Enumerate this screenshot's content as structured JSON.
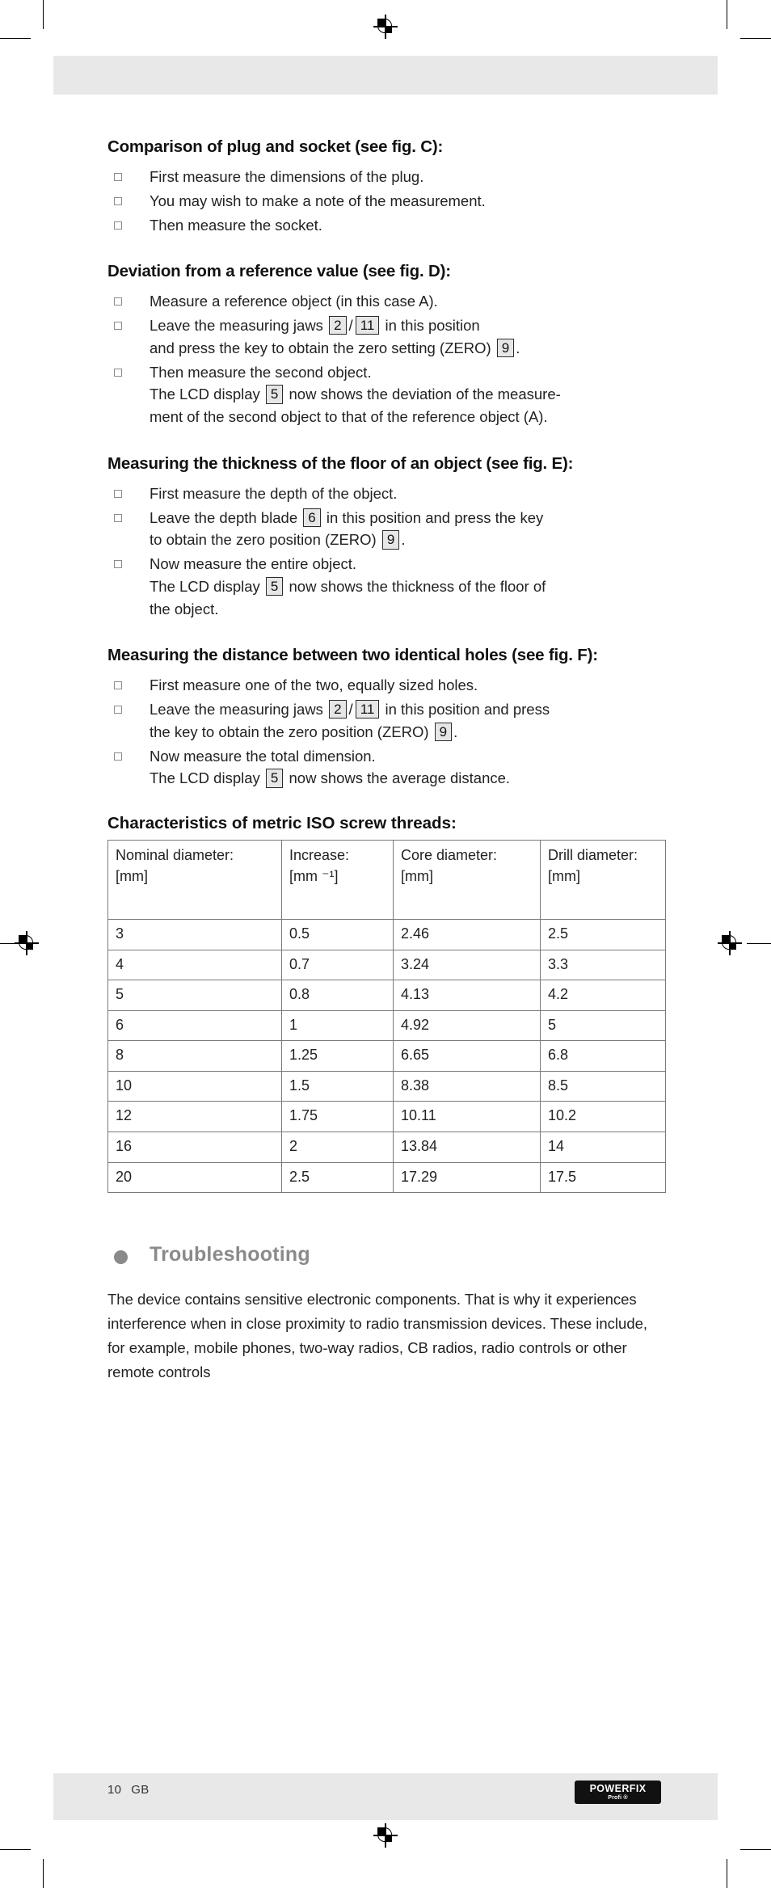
{
  "page": {
    "footer_page_number": "10",
    "footer_language_code": "GB",
    "brand_name": "POWERFIX",
    "brand_sub": "Profi ®"
  },
  "sections": [
    {
      "heading": "Comparison of plug and socket (see fig. C):",
      "steps": [
        {
          "parts": [
            {
              "t": "text",
              "v": "First measure the dimensions of the plug."
            }
          ]
        },
        {
          "parts": [
            {
              "t": "text",
              "v": "You may wish to make a note of the measurement."
            }
          ]
        },
        {
          "parts": [
            {
              "t": "text",
              "v": "Then measure the socket."
            }
          ]
        }
      ]
    },
    {
      "heading": "Deviation from a reference value (see fig. D):",
      "steps": [
        {
          "parts": [
            {
              "t": "text",
              "v": "Measure a reference object (in this case A)."
            }
          ]
        },
        {
          "parts": [
            {
              "t": "text",
              "v": "Leave the measuring jaws "
            },
            {
              "t": "ref",
              "v": "2"
            },
            {
              "t": "sep",
              "v": "/"
            },
            {
              "t": "ref",
              "v": "11"
            },
            {
              "t": "text",
              "v": " in this position"
            },
            {
              "t": "break",
              "v": ""
            },
            {
              "t": "text",
              "v": "and press the key to obtain the zero setting (ZERO) "
            },
            {
              "t": "ref",
              "v": "9"
            },
            {
              "t": "text",
              "v": "."
            }
          ]
        },
        {
          "parts": [
            {
              "t": "text",
              "v": "Then measure the second object."
            },
            {
              "t": "break",
              "v": ""
            },
            {
              "t": "text",
              "v": "The LCD display "
            },
            {
              "t": "ref",
              "v": "5"
            },
            {
              "t": "text",
              "v": " now shows the deviation of the measure-"
            },
            {
              "t": "break",
              "v": ""
            },
            {
              "t": "text",
              "v": "ment of the second object to that of the reference object (A)."
            }
          ]
        }
      ]
    },
    {
      "heading": "Measuring the thickness of the floor of an object (see fig. E):",
      "steps": [
        {
          "parts": [
            {
              "t": "text",
              "v": "First measure the depth of the object."
            }
          ]
        },
        {
          "parts": [
            {
              "t": "text",
              "v": "Leave the depth blade "
            },
            {
              "t": "ref",
              "v": "6"
            },
            {
              "t": "text",
              "v": " in this position and press the key"
            },
            {
              "t": "break",
              "v": ""
            },
            {
              "t": "text",
              "v": "to obtain the zero position (ZERO) "
            },
            {
              "t": "ref",
              "v": "9"
            },
            {
              "t": "text",
              "v": "."
            }
          ]
        },
        {
          "parts": [
            {
              "t": "text",
              "v": "Now measure the entire object."
            },
            {
              "t": "break",
              "v": ""
            },
            {
              "t": "text",
              "v": "The LCD display "
            },
            {
              "t": "ref",
              "v": "5"
            },
            {
              "t": "text",
              "v": " now shows the thickness of the floor of"
            },
            {
              "t": "break",
              "v": ""
            },
            {
              "t": "text",
              "v": "the object."
            }
          ]
        }
      ]
    },
    {
      "heading": "Measuring the distance between two identical holes (see fig. F):",
      "steps": [
        {
          "parts": [
            {
              "t": "text",
              "v": "First measure one of the two, equally sized holes."
            }
          ]
        },
        {
          "parts": [
            {
              "t": "text",
              "v": "Leave the measuring jaws "
            },
            {
              "t": "ref",
              "v": "2"
            },
            {
              "t": "sep",
              "v": "/"
            },
            {
              "t": "ref",
              "v": "11"
            },
            {
              "t": "text",
              "v": " in this position and press"
            },
            {
              "t": "break",
              "v": ""
            },
            {
              "t": "text",
              "v": "the key to obtain the zero position (ZERO) "
            },
            {
              "t": "ref",
              "v": "9"
            },
            {
              "t": "text",
              "v": "."
            }
          ]
        },
        {
          "parts": [
            {
              "t": "text",
              "v": "Now measure the total dimension."
            },
            {
              "t": "break",
              "v": ""
            },
            {
              "t": "text",
              "v": "The LCD display "
            },
            {
              "t": "ref",
              "v": "5"
            },
            {
              "t": "text",
              "v": " now shows the average distance."
            }
          ]
        }
      ]
    }
  ],
  "table": {
    "heading": "Characteristics of metric ISO screw threads:",
    "columns": [
      {
        "label": "Nominal diameter:",
        "unit": "[mm]"
      },
      {
        "label": "Increase:",
        "unit": "[mm ⁻¹]"
      },
      {
        "label": "Core diameter:",
        "unit": "[mm]"
      },
      {
        "label": "Drill diameter:",
        "unit": "[mm]"
      }
    ],
    "rows": [
      [
        "3",
        "0.5",
        "2.46",
        "2.5"
      ],
      [
        "4",
        "0.7",
        "3.24",
        "3.3"
      ],
      [
        "5",
        "0.8",
        "4.13",
        "4.2"
      ],
      [
        "6",
        "1",
        "4.92",
        "5"
      ],
      [
        "8",
        "1.25",
        "6.65",
        "6.8"
      ],
      [
        "10",
        "1.5",
        "8.38",
        "8.5"
      ],
      [
        "12",
        "1.75",
        "10.11",
        "10.2"
      ],
      [
        "16",
        "2",
        "13.84",
        "14"
      ],
      [
        "20",
        "2.5",
        "17.29",
        "17.5"
      ]
    ]
  },
  "troubleshooting": {
    "heading": "Troubleshooting",
    "paragraph": "The device contains sensitive electronic components. That is why it experiences interference when in close proximity to radio transmission devices. These include, for example, mobile phones, two-way radios, CB radios, radio controls or other remote controls"
  }
}
